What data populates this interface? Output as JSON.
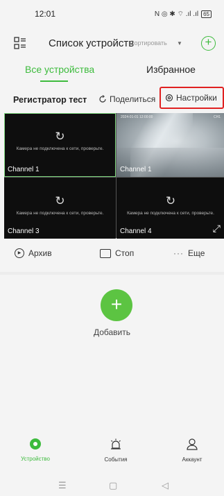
{
  "status_bar": {
    "time": "12:01",
    "icons": "N ◎ ✱ ⌔ .ıl .ıl",
    "battery": "65"
  },
  "header": {
    "title": "Список устройств",
    "sort_label": "Сортировать",
    "sort_caret": "▼",
    "add_symbol": "+"
  },
  "tabs": [
    {
      "label": "Все устройства",
      "active": true
    },
    {
      "label": "Избранное",
      "active": false
    }
  ],
  "group": {
    "name": "Регистратор тест",
    "share_label": "Поделиться",
    "settings_label": "Настройки"
  },
  "channels": [
    {
      "label": "Channel 1",
      "connected": false,
      "selected": true,
      "message": "Камера не подключена к сети, проверьте."
    },
    {
      "label": "Channel 1",
      "connected": true,
      "selected": false,
      "timestamp_left": "2024-01-01 12:00:00",
      "timestamp_right": "CH1"
    },
    {
      "label": "Channel 3",
      "connected": false,
      "selected": false,
      "message": "Камера не подключена к сети, проверьте."
    },
    {
      "label": "Channel 4",
      "connected": false,
      "selected": false,
      "message": "Камера не подключена к сети, проверьте."
    }
  ],
  "actions": {
    "archive": "Архив",
    "stop": "Стоп",
    "more": "Еще"
  },
  "add_device": {
    "symbol": "+",
    "label": "Добавить"
  },
  "bottom_nav": [
    {
      "label": "Устройство",
      "active": true
    },
    {
      "label": "События",
      "active": false
    },
    {
      "label": "Аккаунт",
      "active": false
    }
  ],
  "colors": {
    "accent": "#3dbb3d",
    "fab": "#5cc442",
    "highlight": "#e02020"
  }
}
